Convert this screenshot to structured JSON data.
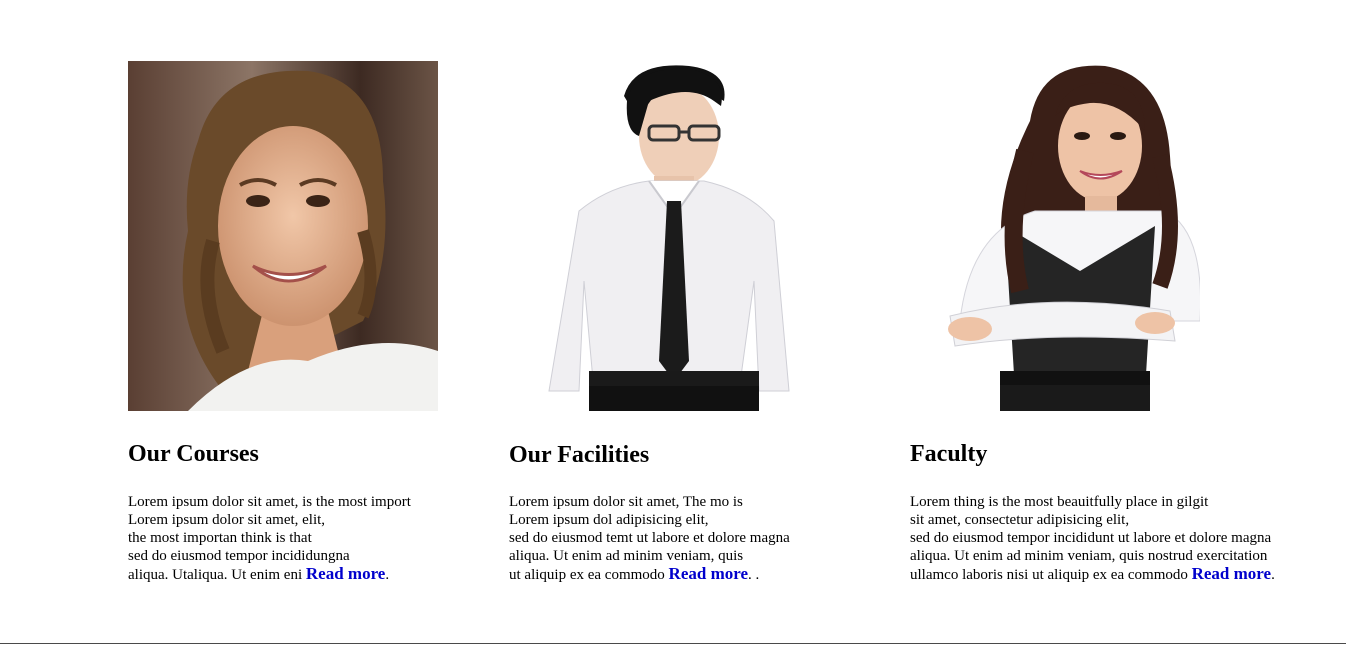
{
  "cards": [
    {
      "title": "Our Courses",
      "lines": [
        "Lorem ipsum dolor sit amet, is the most import",
        "Lorem ipsum dolor sit amet, elit,",
        "the most importan think is that",
        "sed do eiusmod tempor incididungna"
      ],
      "last_line": "aliqua. Utaliqua. Ut enim eni ",
      "read_more": "Read more",
      "tail": "."
    },
    {
      "title": "Our Facilities",
      "lines": [
        "Lorem ipsum dolor sit amet, The mo is",
        "Lorem ipsum dol adipisicing elit,",
        "sed do eiusmod temt ut labore et dolore magna",
        "aliqua. Ut enim ad minim veniam, quis"
      ],
      "last_line": "ut aliquip ex ea commodo ",
      "read_more": "Read more",
      "tail": ". ."
    },
    {
      "title": "Faculty",
      "lines": [
        "Lorem thing is the most beauitfully place in gilgit",
        "sit amet, consectetur adipisicing elit,",
        "sed do eiusmod tempor incididunt ut labore et dolore magna",
        "aliqua. Ut enim ad minim veniam, quis nostrud exercitation"
      ],
      "last_line": "ullamco laboris nisi ut aliquip ex ea commodo ",
      "read_more": "Read more",
      "tail": "."
    }
  ],
  "colors": {
    "link": "#0000cc",
    "footer_line": "#4a4a4a"
  }
}
